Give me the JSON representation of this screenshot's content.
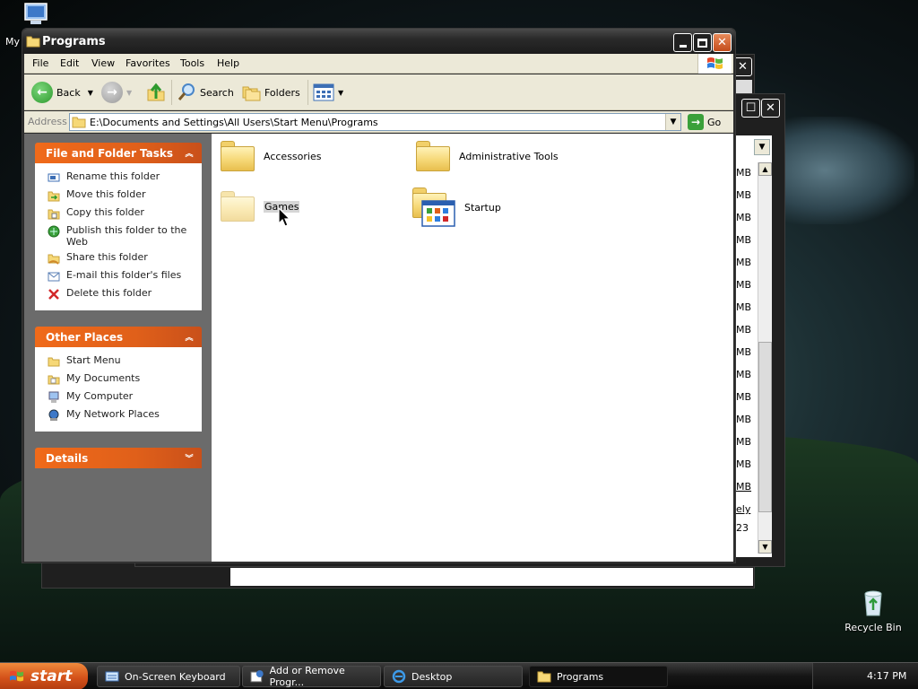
{
  "desktop": {
    "my_computer_label": "My",
    "recycle_bin_label": "Recycle Bin"
  },
  "window": {
    "title": "Programs",
    "menu": [
      "File",
      "Edit",
      "View",
      "Favorites",
      "Tools",
      "Help"
    ],
    "toolbar": {
      "back": "Back",
      "search": "Search",
      "folders": "Folders"
    },
    "address": {
      "label": "Address",
      "value": "E:\\Documents and Settings\\All Users\\Start Menu\\Programs",
      "go": "Go"
    },
    "file_folder_tasks": {
      "title": "File and Folder Tasks",
      "items": [
        {
          "label": "Rename this folder",
          "icon": "rename-icon"
        },
        {
          "label": "Move this folder",
          "icon": "move-icon"
        },
        {
          "label": "Copy this folder",
          "icon": "copy-icon"
        },
        {
          "label": "Publish this folder to the Web",
          "icon": "publish-icon"
        },
        {
          "label": "Share this folder",
          "icon": "share-icon"
        },
        {
          "label": "E-mail this folder's files",
          "icon": "email-icon"
        },
        {
          "label": "Delete this folder",
          "icon": "delete-icon"
        }
      ]
    },
    "other_places": {
      "title": "Other Places",
      "items": [
        {
          "label": "Start Menu",
          "icon": "folder-icon"
        },
        {
          "label": "My Documents",
          "icon": "my-documents-icon"
        },
        {
          "label": "My Computer",
          "icon": "my-computer-icon"
        },
        {
          "label": "My Network Places",
          "icon": "network-icon"
        }
      ]
    },
    "details": {
      "title": "Details"
    },
    "folders": [
      {
        "label": "Accessories"
      },
      {
        "label": "Administrative Tools"
      },
      {
        "label": "Games"
      },
      {
        "label": "Startup"
      }
    ]
  },
  "back_window": {
    "sizes": [
      "MB",
      "MB",
      "MB",
      "MB",
      "MB",
      "MB",
      "MB",
      "MB",
      "MB",
      "MB",
      "MB",
      "MB",
      "MB",
      "MB",
      "MB"
    ],
    "link_text": "ely",
    "number_text": "23"
  },
  "taskbar": {
    "start": "start",
    "buttons": [
      {
        "label": "On-Screen Keyboard",
        "icon": "keyboard-icon"
      },
      {
        "label": "Add or Remove Progr...",
        "icon": "add-remove-icon"
      },
      {
        "label": "Desktop",
        "icon": "ie-icon"
      },
      {
        "label": "Programs",
        "icon": "folder-icon"
      }
    ],
    "clock": "4:17 PM"
  },
  "colors": {
    "task_header": "#e0601a",
    "titlebar": "#2a2a2a",
    "folder_yellow": "#f6d877"
  }
}
